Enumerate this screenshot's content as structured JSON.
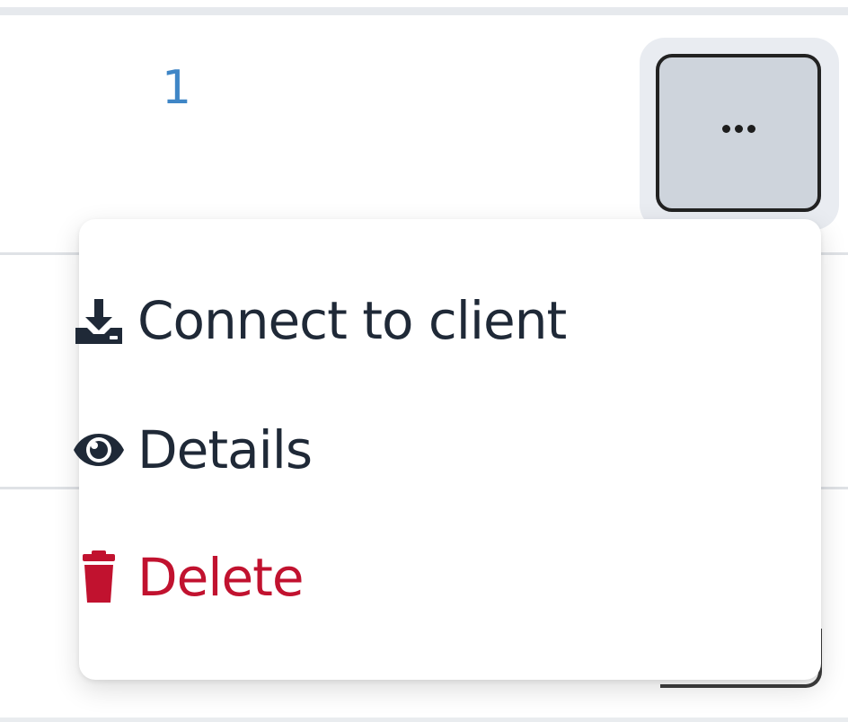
{
  "row": {
    "count": "1"
  },
  "menu": {
    "toggle_icon": "ellipsis-icon",
    "items": [
      {
        "label": "Connect to client",
        "icon": "download-icon",
        "color": "#1f2937"
      },
      {
        "label": "Details",
        "icon": "eye-icon",
        "color": "#1f2937"
      },
      {
        "label": "Delete",
        "icon": "trash-icon",
        "color": "#c1122f"
      }
    ]
  }
}
